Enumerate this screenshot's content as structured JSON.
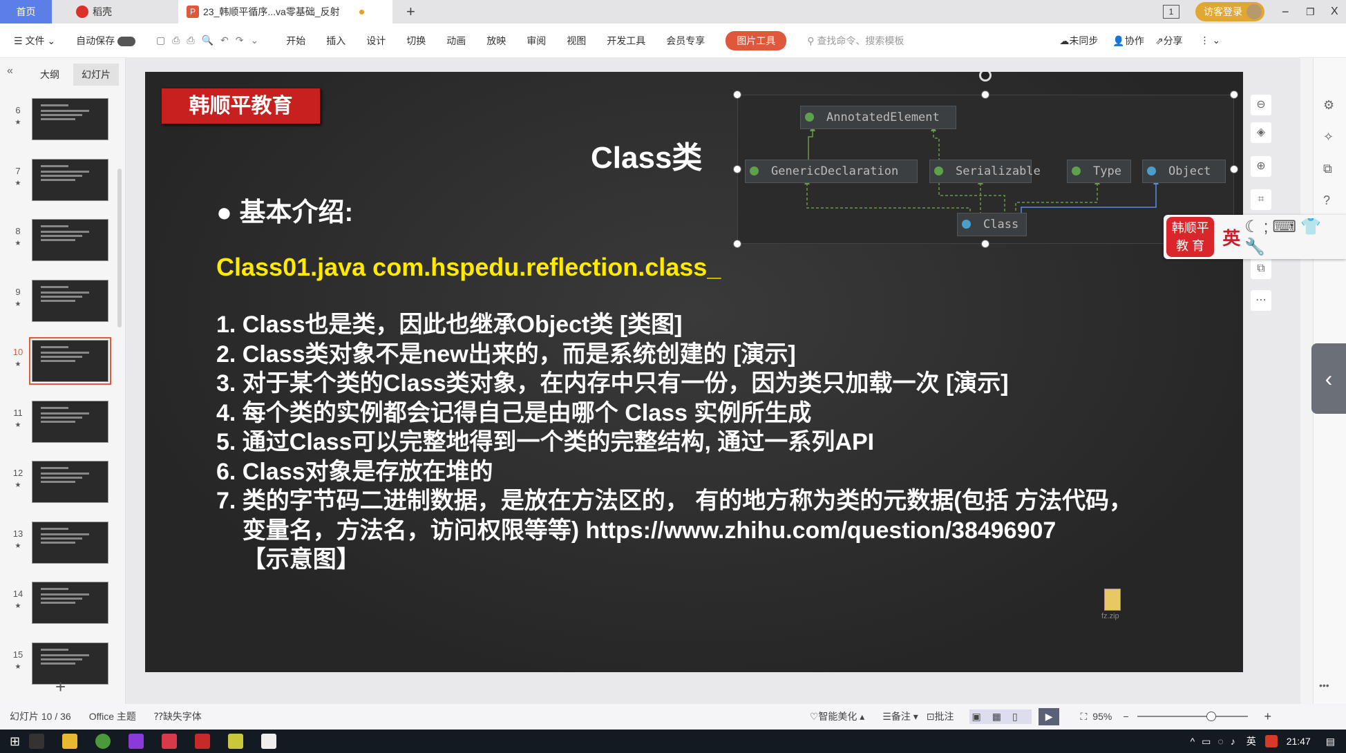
{
  "tabs": {
    "home": "首页",
    "daoke": "稻壳",
    "doc": "23_韩顺平循序...va零基础_反射",
    "new": "+"
  },
  "titlebar": {
    "page_badge": "1",
    "login": "访客登录",
    "minimize": "−",
    "restore": "❐",
    "close": "X"
  },
  "toolbar": {
    "file": "文件",
    "autosave": "自动保存",
    "menus": [
      "开始",
      "插入",
      "设计",
      "切换",
      "动画",
      "放映",
      "审阅",
      "视图",
      "开发工具",
      "会员专享"
    ],
    "picture_tools": "图片工具",
    "search_placeholder": "查找命令、搜索模板",
    "sync": "未同步",
    "collab": "协作",
    "share": "分享"
  },
  "left_panel": {
    "outline_tab": "大纲",
    "slides_tab": "幻灯片",
    "slide_numbers": [
      "6",
      "7",
      "8",
      "9",
      "10",
      "11",
      "12",
      "13",
      "14",
      "15"
    ],
    "active": "10",
    "add": "+"
  },
  "slide": {
    "logo": "韩顺平教育",
    "title": "Class类",
    "heading": "基本介绍:",
    "file_line": "Class01.java  com.hspedu.reflection.class_",
    "items": [
      "1. Class也是类，因此也继承Object类 [类图]",
      "2. Class类对象不是new出来的，而是系统创建的 [演示]",
      "3. 对于某个类的Class类对象，在内存中只有一份，因为类只加载一次 [演示]",
      "4. 每个类的实例都会记得自己是由哪个 Class 实例所生成",
      "5. 通过Class可以完整地得到一个类的完整结构, 通过一系列API",
      "6. Class对象是存放在堆的",
      "7. 类的字节码二进制数据，是放在方法区的， 有的地方称为类的元数据(包括 方法代码，",
      "    变量名，方法名，访问权限等等) https://www.zhihu.com/question/38496907",
      "    【示意图】"
    ],
    "zip_label": "fz.zip"
  },
  "diagram": {
    "nodes": [
      "AnnotatedElement",
      "GenericDeclaration",
      "Serializable",
      "Type",
      "Object",
      "Class"
    ]
  },
  "ime": {
    "logo_line1": "韩顺平",
    "logo_line2": "教 育",
    "lang": "英"
  },
  "status": {
    "slide_pos": "幻灯片 10 / 36",
    "theme": "Office 主题",
    "missing_font": "缺失字体",
    "beautify": "智能美化",
    "notes": "备注",
    "comment": "批注",
    "zoom": "95%"
  },
  "taskbar": {
    "ime": "英",
    "time": "21:47"
  }
}
